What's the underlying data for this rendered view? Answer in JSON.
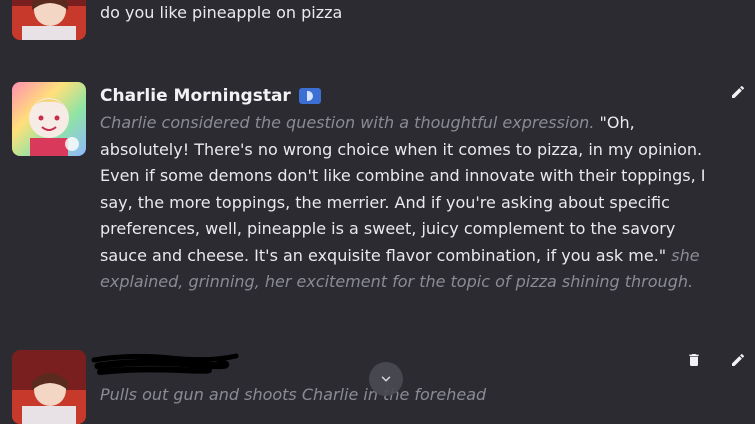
{
  "messages": [
    {
      "id": "user-top",
      "text": "do you like pineapple on pizza"
    },
    {
      "id": "charlie",
      "name": "Charlie Morningstar",
      "action_prefix": "Charlie considered the question with a thoughtful expression.",
      "speech": " \"Oh, absolutely! There's no wrong choice when it comes to pizza, in my opinion. Even if some demons don't like combine and innovate with their toppings, I say, the more toppings, the merrier. And if you're asking about specific preferences, well, pineapple is a sweet, juicy complement to the savory sauce and cheese. It's an exquisite flavor combination, if you ask me.\"",
      "action_suffix": " she explained, grinning, her excitement for the topic of pizza shining through."
    },
    {
      "id": "user-bottom",
      "text": "Pulls out gun and shoots Charlie in the forehead"
    }
  ],
  "icons": {
    "edit": "pencil-icon",
    "delete": "trash-icon",
    "scroll": "chevron-down-icon",
    "bot_badge": "bot-badge-icon"
  },
  "colors": {
    "background": "#2b2b31",
    "text": "#e9e9ee",
    "action_text": "#8b8b93",
    "badge": "#3b6fd4"
  }
}
